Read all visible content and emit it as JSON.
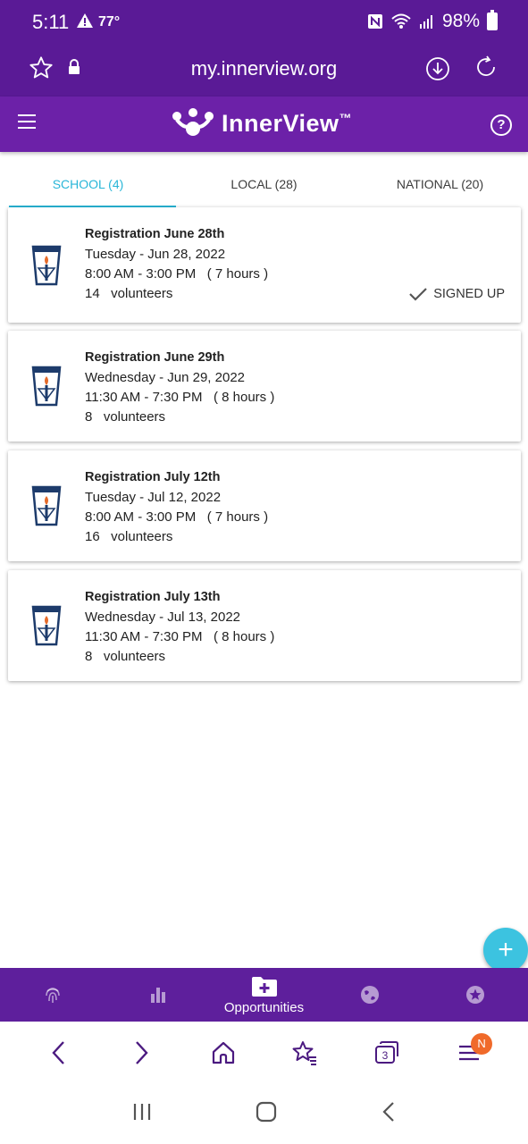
{
  "status_bar": {
    "time": "5:11",
    "temperature": "77°",
    "battery": "98%"
  },
  "browser": {
    "url": "my.innerview.org"
  },
  "app": {
    "logo_text": "InnerView",
    "logo_tm": "™"
  },
  "tabs": [
    {
      "label": "SCHOOL (4)",
      "active": true
    },
    {
      "label": "LOCAL (28)",
      "active": false
    },
    {
      "label": "NATIONAL (20)",
      "active": false
    }
  ],
  "opportunities": [
    {
      "title": "Registration June 28th",
      "date": "Tuesday - Jun 28, 2022",
      "time": "8:00 AM - 3:00 PM   ( 7 hours )",
      "volunteers": "14   volunteers",
      "status": "SIGNED UP"
    },
    {
      "title": "Registration June 29th",
      "date": "Wednesday - Jun 29, 2022",
      "time": "11:30 AM - 7:30 PM   ( 8 hours )",
      "volunteers": "8   volunteers",
      "status": ""
    },
    {
      "title": "Registration July 12th",
      "date": "Tuesday - Jul 12, 2022",
      "time": "8:00 AM - 3:00 PM   ( 7 hours )",
      "volunteers": "16   volunteers",
      "status": ""
    },
    {
      "title": "Registration July 13th",
      "date": "Wednesday - Jul 13, 2022",
      "time": "11:30 AM - 7:30 PM   ( 8 hours )",
      "volunteers": "8   volunteers",
      "status": ""
    }
  ],
  "fab": {
    "symbol": "+"
  },
  "bottom_nav": {
    "active_label": "Opportunities"
  },
  "browser_toolbar": {
    "tabs_count": "3",
    "profile_badge": "N"
  }
}
